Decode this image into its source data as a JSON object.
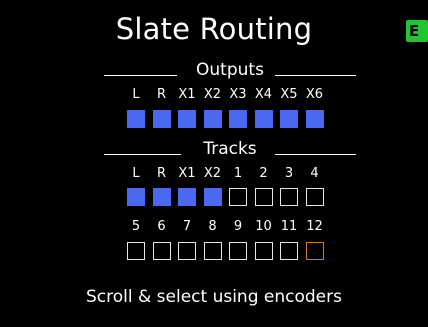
{
  "screen": {
    "title": "Slate Routing",
    "exit_icon": "exit-icon",
    "exit_glyph": "E"
  },
  "outputs": {
    "heading": "Outputs",
    "channels": [
      {
        "label": "L",
        "state": "on"
      },
      {
        "label": "R",
        "state": "on"
      },
      {
        "label": "X1",
        "state": "on"
      },
      {
        "label": "X2",
        "state": "on"
      },
      {
        "label": "X3",
        "state": "on"
      },
      {
        "label": "X4",
        "state": "on"
      },
      {
        "label": "X5",
        "state": "on"
      },
      {
        "label": "X6",
        "state": "on"
      }
    ]
  },
  "tracks": {
    "heading": "Tracks",
    "row1": [
      {
        "label": "L",
        "state": "on"
      },
      {
        "label": "R",
        "state": "on"
      },
      {
        "label": "X1",
        "state": "on"
      },
      {
        "label": "X2",
        "state": "on"
      },
      {
        "label": "1",
        "state": "off"
      },
      {
        "label": "2",
        "state": "off"
      },
      {
        "label": "3",
        "state": "off"
      },
      {
        "label": "4",
        "state": "off"
      }
    ],
    "row2": [
      {
        "label": "5",
        "state": "off"
      },
      {
        "label": "6",
        "state": "off"
      },
      {
        "label": "7",
        "state": "off"
      },
      {
        "label": "8",
        "state": "off"
      },
      {
        "label": "9",
        "state": "off"
      },
      {
        "label": "10",
        "state": "off"
      },
      {
        "label": "11",
        "state": "off"
      },
      {
        "label": "12",
        "state": "cursor"
      }
    ]
  },
  "hint": "Scroll & select using encoders",
  "colors": {
    "selected": "#4b68f1",
    "cursor": "#d27a2a",
    "exit": "#22c531"
  }
}
